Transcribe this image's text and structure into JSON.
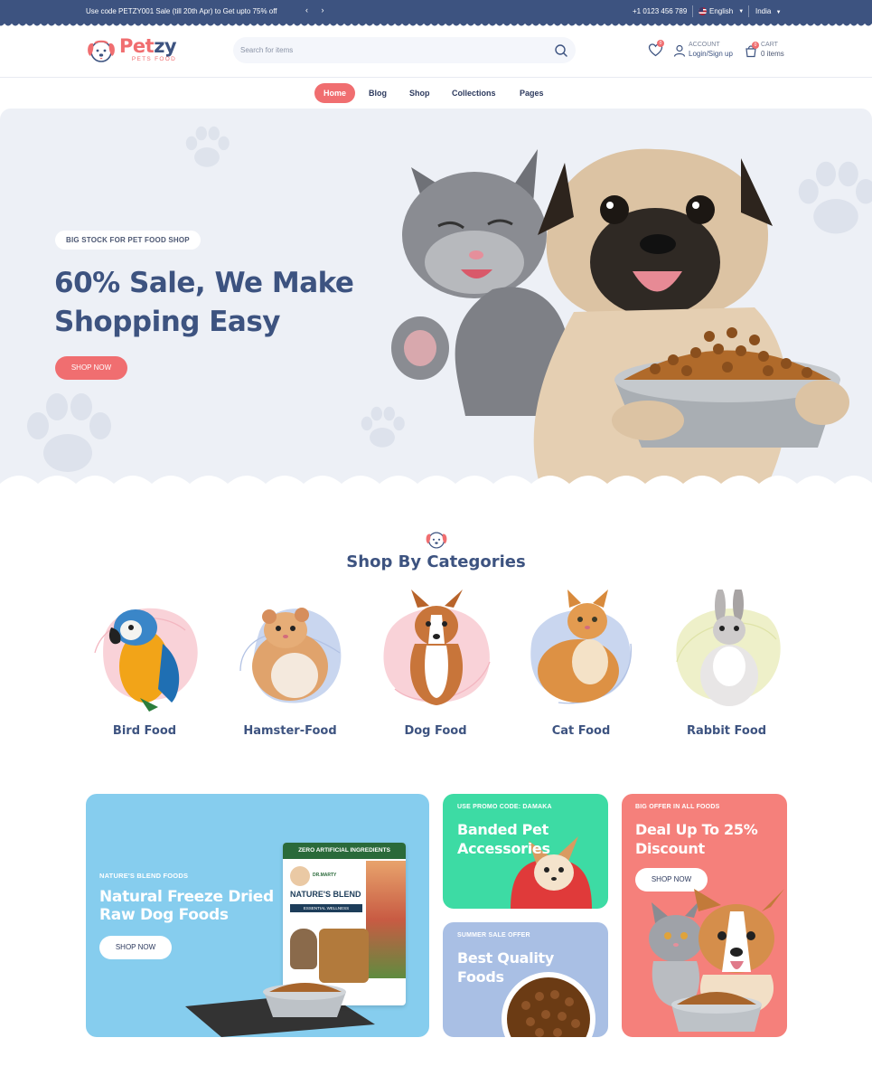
{
  "topbar": {
    "promo": "Use code PETZY001 Sale (till 20th Apr) to Get upto 75% off",
    "arrows": "‹ ›",
    "phone": "+1 0123 456 789",
    "language": "English",
    "country": "India"
  },
  "header": {
    "logo_name_a": "Pet",
    "logo_name_b": "zy",
    "logo_sub": "PETS FOOD",
    "search_placeholder": "Search for items",
    "wishlist_count": "0",
    "account_label": "ACCOUNT",
    "account_value": "Login/Sign up",
    "cart_label": "CART",
    "cart_count": "0",
    "cart_value": "0 items"
  },
  "nav": {
    "items": [
      "Home",
      "Blog",
      "Shop",
      "Collections",
      "Pages"
    ]
  },
  "hero": {
    "pill": "BIG STOCK FOR PET FOOD SHOP",
    "title": "60% Sale, We Make Shopping Easy",
    "button": "SHOP NOW"
  },
  "categories": {
    "title": "Shop By Categories",
    "items": [
      {
        "label": "Bird Food",
        "icon": "parrot-image"
      },
      {
        "label": "Hamster-Food",
        "icon": "hamster-image"
      },
      {
        "label": "Dog Food",
        "icon": "corgi-image"
      },
      {
        "label": "Cat Food",
        "icon": "cat-image"
      },
      {
        "label": "Rabbit Food",
        "icon": "rabbit-image"
      }
    ]
  },
  "banners": {
    "natural": {
      "kicker": "NATURE'S BLEND FOODS",
      "title": "Natural Freeze Dried Raw Dog Foods",
      "button": "SHOP NOW",
      "pack_top": "ZERO ARTIFICIAL INGREDIENTS",
      "pack_brand": "DR.MARTY",
      "pack_name": "NATURE'S BLEND",
      "pack_sub": "ESSENTIAL WELLNESS",
      "color": "#86cdee"
    },
    "accessories": {
      "kicker": "USE PROMO CODE: DAMAKA",
      "title": "Banded Pet Accessories",
      "color": "#3ddba4"
    },
    "quality": {
      "kicker": "SUMMER SALE OFFER",
      "title": "Best Quality Foods",
      "color": "#a9bfe4"
    },
    "deal": {
      "kicker": "BIG OFFER IN ALL FOODS",
      "title": "Deal Up To 25% Discount",
      "button": "SHOP NOW",
      "color": "#f5807b"
    }
  },
  "colors": {
    "brand_navy": "#3d5380",
    "brand_coral": "#f06e70",
    "hero_bg": "#edf0f6"
  }
}
